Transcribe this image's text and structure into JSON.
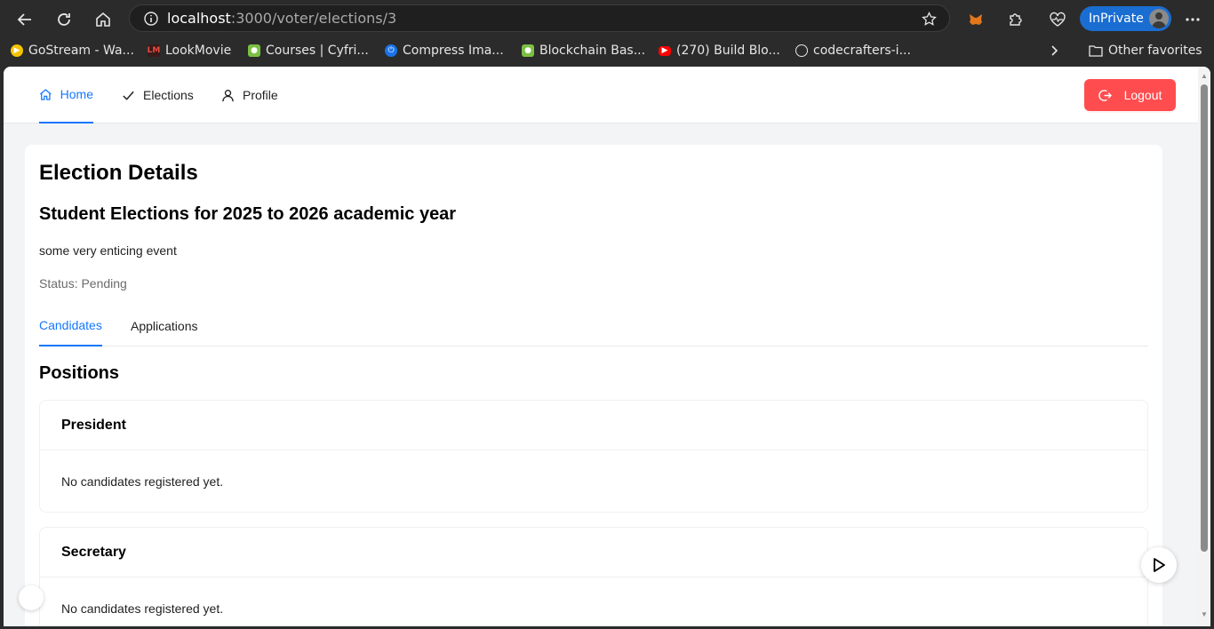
{
  "browser": {
    "url_host": "localhost",
    "url_path": ":3000/voter/elections/3",
    "inprivate_label": "InPrivate",
    "bookmarks": [
      {
        "label": "GoStream - Wa...",
        "color": "#f5c400"
      },
      {
        "label": "LookMovie",
        "color": "#c0392b"
      },
      {
        "label": "Courses | Cyfri...",
        "color": "#7bc043"
      },
      {
        "label": "Compress Ima...",
        "color": "#1a73e8"
      },
      {
        "label": "Blockchain Bas...",
        "color": "#7bc043"
      },
      {
        "label": "(270) Build Blo...",
        "color": "#ff0000"
      },
      {
        "label": "codecrafters-i...",
        "color": "#ffffff"
      }
    ],
    "other_favorites": "Other favorites"
  },
  "header": {
    "menu": [
      {
        "label": "Home",
        "icon": "home-icon",
        "active": true
      },
      {
        "label": "Elections",
        "icon": "check-icon",
        "active": false
      },
      {
        "label": "Profile",
        "icon": "user-icon",
        "active": false
      }
    ],
    "logout_label": "Logout",
    "accent": "#1677ff",
    "danger": "#ff4d4f"
  },
  "election": {
    "page_title": "Election Details",
    "name": "Student Elections for 2025 to 2026 academic year",
    "description": "some very enticing event",
    "status": "Status: Pending"
  },
  "tabs": [
    {
      "label": "Candidates",
      "active": true
    },
    {
      "label": "Applications",
      "active": false
    }
  ],
  "positions": {
    "title": "Positions",
    "items": [
      {
        "name": "President",
        "empty_text": "No candidates registered yet."
      },
      {
        "name": "Secretary",
        "empty_text": "No candidates registered yet."
      }
    ]
  }
}
